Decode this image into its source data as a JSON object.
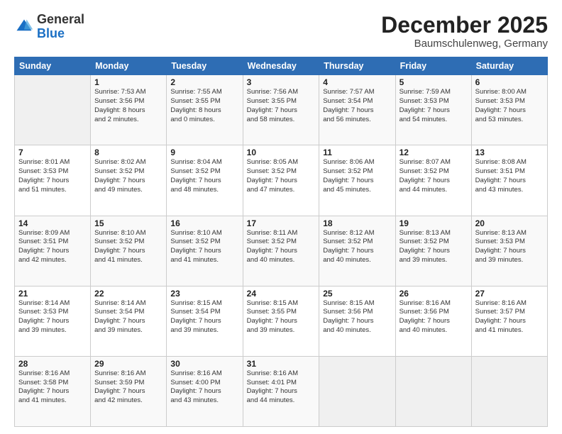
{
  "header": {
    "logo_general": "General",
    "logo_blue": "Blue",
    "month_title": "December 2025",
    "location": "Baumschulenweg, Germany"
  },
  "days_of_week": [
    "Sunday",
    "Monday",
    "Tuesday",
    "Wednesday",
    "Thursday",
    "Friday",
    "Saturday"
  ],
  "weeks": [
    [
      {
        "day": "",
        "info": ""
      },
      {
        "day": "1",
        "info": "Sunrise: 7:53 AM\nSunset: 3:56 PM\nDaylight: 8 hours\nand 2 minutes."
      },
      {
        "day": "2",
        "info": "Sunrise: 7:55 AM\nSunset: 3:55 PM\nDaylight: 8 hours\nand 0 minutes."
      },
      {
        "day": "3",
        "info": "Sunrise: 7:56 AM\nSunset: 3:55 PM\nDaylight: 7 hours\nand 58 minutes."
      },
      {
        "day": "4",
        "info": "Sunrise: 7:57 AM\nSunset: 3:54 PM\nDaylight: 7 hours\nand 56 minutes."
      },
      {
        "day": "5",
        "info": "Sunrise: 7:59 AM\nSunset: 3:53 PM\nDaylight: 7 hours\nand 54 minutes."
      },
      {
        "day": "6",
        "info": "Sunrise: 8:00 AM\nSunset: 3:53 PM\nDaylight: 7 hours\nand 53 minutes."
      }
    ],
    [
      {
        "day": "7",
        "info": "Sunrise: 8:01 AM\nSunset: 3:53 PM\nDaylight: 7 hours\nand 51 minutes."
      },
      {
        "day": "8",
        "info": "Sunrise: 8:02 AM\nSunset: 3:52 PM\nDaylight: 7 hours\nand 49 minutes."
      },
      {
        "day": "9",
        "info": "Sunrise: 8:04 AM\nSunset: 3:52 PM\nDaylight: 7 hours\nand 48 minutes."
      },
      {
        "day": "10",
        "info": "Sunrise: 8:05 AM\nSunset: 3:52 PM\nDaylight: 7 hours\nand 47 minutes."
      },
      {
        "day": "11",
        "info": "Sunrise: 8:06 AM\nSunset: 3:52 PM\nDaylight: 7 hours\nand 45 minutes."
      },
      {
        "day": "12",
        "info": "Sunrise: 8:07 AM\nSunset: 3:52 PM\nDaylight: 7 hours\nand 44 minutes."
      },
      {
        "day": "13",
        "info": "Sunrise: 8:08 AM\nSunset: 3:51 PM\nDaylight: 7 hours\nand 43 minutes."
      }
    ],
    [
      {
        "day": "14",
        "info": "Sunrise: 8:09 AM\nSunset: 3:51 PM\nDaylight: 7 hours\nand 42 minutes."
      },
      {
        "day": "15",
        "info": "Sunrise: 8:10 AM\nSunset: 3:52 PM\nDaylight: 7 hours\nand 41 minutes."
      },
      {
        "day": "16",
        "info": "Sunrise: 8:10 AM\nSunset: 3:52 PM\nDaylight: 7 hours\nand 41 minutes."
      },
      {
        "day": "17",
        "info": "Sunrise: 8:11 AM\nSunset: 3:52 PM\nDaylight: 7 hours\nand 40 minutes."
      },
      {
        "day": "18",
        "info": "Sunrise: 8:12 AM\nSunset: 3:52 PM\nDaylight: 7 hours\nand 40 minutes."
      },
      {
        "day": "19",
        "info": "Sunrise: 8:13 AM\nSunset: 3:52 PM\nDaylight: 7 hours\nand 39 minutes."
      },
      {
        "day": "20",
        "info": "Sunrise: 8:13 AM\nSunset: 3:53 PM\nDaylight: 7 hours\nand 39 minutes."
      }
    ],
    [
      {
        "day": "21",
        "info": "Sunrise: 8:14 AM\nSunset: 3:53 PM\nDaylight: 7 hours\nand 39 minutes."
      },
      {
        "day": "22",
        "info": "Sunrise: 8:14 AM\nSunset: 3:54 PM\nDaylight: 7 hours\nand 39 minutes."
      },
      {
        "day": "23",
        "info": "Sunrise: 8:15 AM\nSunset: 3:54 PM\nDaylight: 7 hours\nand 39 minutes."
      },
      {
        "day": "24",
        "info": "Sunrise: 8:15 AM\nSunset: 3:55 PM\nDaylight: 7 hours\nand 39 minutes."
      },
      {
        "day": "25",
        "info": "Sunrise: 8:15 AM\nSunset: 3:56 PM\nDaylight: 7 hours\nand 40 minutes."
      },
      {
        "day": "26",
        "info": "Sunrise: 8:16 AM\nSunset: 3:56 PM\nDaylight: 7 hours\nand 40 minutes."
      },
      {
        "day": "27",
        "info": "Sunrise: 8:16 AM\nSunset: 3:57 PM\nDaylight: 7 hours\nand 41 minutes."
      }
    ],
    [
      {
        "day": "28",
        "info": "Sunrise: 8:16 AM\nSunset: 3:58 PM\nDaylight: 7 hours\nand 41 minutes."
      },
      {
        "day": "29",
        "info": "Sunrise: 8:16 AM\nSunset: 3:59 PM\nDaylight: 7 hours\nand 42 minutes."
      },
      {
        "day": "30",
        "info": "Sunrise: 8:16 AM\nSunset: 4:00 PM\nDaylight: 7 hours\nand 43 minutes."
      },
      {
        "day": "31",
        "info": "Sunrise: 8:16 AM\nSunset: 4:01 PM\nDaylight: 7 hours\nand 44 minutes."
      },
      {
        "day": "",
        "info": ""
      },
      {
        "day": "",
        "info": ""
      },
      {
        "day": "",
        "info": ""
      }
    ]
  ]
}
